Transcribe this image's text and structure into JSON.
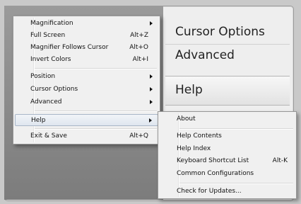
{
  "background_window": {
    "items": [
      {
        "label": "Cursor Options"
      },
      {
        "label": "Advanced"
      },
      {
        "label": "Help"
      }
    ]
  },
  "main_menu": {
    "items": [
      {
        "label": "Magnification",
        "submenu": true
      },
      {
        "label": "Full Screen",
        "accel": "Alt+Z"
      },
      {
        "label": "Magnifier Follows Cursor",
        "accel": "Alt+O"
      },
      {
        "label": "Invert Colors",
        "accel": "Alt+I"
      },
      {
        "label": "Position",
        "submenu": true
      },
      {
        "label": "Cursor Options",
        "submenu": true
      },
      {
        "label": "Advanced",
        "submenu": true
      },
      {
        "label": "Help",
        "submenu": true,
        "highlighted": true
      },
      {
        "label": "Exit  & Save",
        "accel": "Alt+Q"
      }
    ]
  },
  "help_submenu": {
    "items": [
      {
        "label": "About"
      },
      {
        "label": "Help Contents"
      },
      {
        "label": "Help Index"
      },
      {
        "label": "Keyboard Shortcut List",
        "accel": "Alt-K"
      },
      {
        "label": "Common Configurations"
      },
      {
        "label": "Check for Updates..."
      }
    ]
  }
}
